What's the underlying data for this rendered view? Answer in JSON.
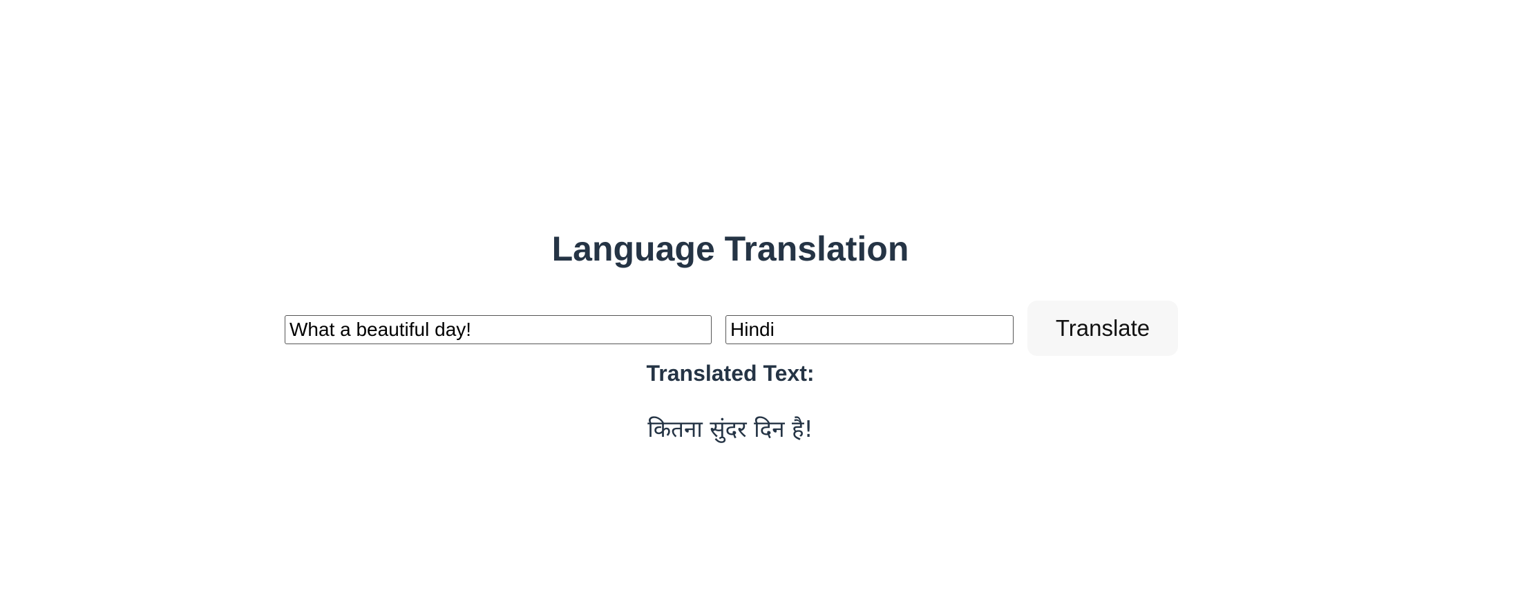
{
  "app": {
    "title": "Language Translation"
  },
  "form": {
    "text_input_value": "What a beautiful day!",
    "language_input_value": "Hindi",
    "translate_button_label": "Translate"
  },
  "result": {
    "heading": "Translated Text:",
    "text": "कितना सुंदर दिन है!"
  },
  "colors": {
    "heading_text": "#253445",
    "button_bg": "#f7f7f7",
    "input_border": "#555555"
  }
}
